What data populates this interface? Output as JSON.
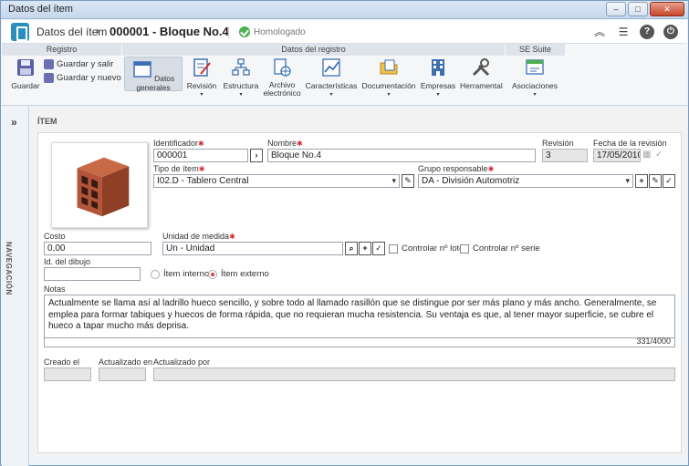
{
  "window": {
    "title": "Datos del ítem",
    "controls": [
      "–",
      "□",
      "✕"
    ]
  },
  "header": {
    "breadcrumb": "Datos del ítem",
    "separator": "›",
    "record_title": "000001 - Bloque No.4",
    "status": "Homologado",
    "icons": [
      "collapse-icon",
      "list-icon",
      "help-icon",
      "power-icon"
    ]
  },
  "ribbon": {
    "groups": {
      "registro": "Registro",
      "datos_registro": "Datos del registro",
      "se_suite": "SE Suite"
    },
    "save_label": "Guardar",
    "save_exit_label": "Guardar y salir",
    "save_new_label": "Guardar y nuevo",
    "buttons": [
      {
        "label": "Datos generales",
        "icon": "window-icon",
        "active": true
      },
      {
        "label": "Revisión",
        "icon": "edit-doc-icon"
      },
      {
        "label": "Estructura",
        "icon": "structure-icon"
      },
      {
        "label": "Archivo electrónico",
        "icon": "file-globe-icon"
      },
      {
        "label": "Características",
        "icon": "chart-icon"
      },
      {
        "label": "Documentación",
        "icon": "folder-icon"
      },
      {
        "label": "Empresas",
        "icon": "building-icon"
      },
      {
        "label": "Herramental",
        "icon": "tools-icon"
      },
      {
        "label": "Asociaciones",
        "icon": "associations-icon"
      }
    ],
    "dropdown_arrow": "▾"
  },
  "sidebar": {
    "toggle": "»",
    "label": "NAVEGACIÓN"
  },
  "section": {
    "title": "ÍTEM"
  },
  "form": {
    "identificador": {
      "label": "Identificador",
      "value": "000001"
    },
    "nombre": {
      "label": "Nombre",
      "value": "Bloque No.4"
    },
    "revision": {
      "label": "Revisión",
      "value": "3"
    },
    "fecha_revision": {
      "label": "Fecha de la revisión",
      "value": "17/05/2010"
    },
    "tipo_item": {
      "label": "Tipo de ítem",
      "value": "I02.D - Tablero Central"
    },
    "grupo_responsable": {
      "label": "Grupo responsable",
      "value": "DA - División Automotriz"
    },
    "costo": {
      "label": "Costo",
      "value": "0,00"
    },
    "unidad_medida": {
      "label": "Unidad de medida",
      "value": "Un - Unidad"
    },
    "controlar_lote": "Controlar nº lote",
    "controlar_serie": "Controlar nº serie",
    "id_dibujo": {
      "label": "Id. del dibujo",
      "value": ""
    },
    "item_interno": "Ítem interno",
    "item_externo": "Ítem externo",
    "notas": {
      "label": "Notas",
      "value": "Actualmente se llama así al ladrillo hueco sencillo, y sobre todo al llamado rasillón que se distingue por ser más plano y más ancho. Generalmente, se emplea para formar tabiques y huecos de forma rápida, que no requieran mucha resistencia. Su ventaja es que, al tener mayor superficie, se cubre el hueco a tapar mucho más deprisa.",
      "counter": "331/4000"
    },
    "creado_el": {
      "label": "Creado el",
      "value": ""
    },
    "actualizado_en": {
      "label": "Actualizado en",
      "value": ""
    },
    "actualizado_por": {
      "label": "Actualizado por",
      "value": ""
    },
    "required_mark": "✱"
  },
  "colors": {
    "accent": "#2a8fbd",
    "required": "#d9272e",
    "status_ok": "#4caf50",
    "brick": "#a8482c"
  }
}
